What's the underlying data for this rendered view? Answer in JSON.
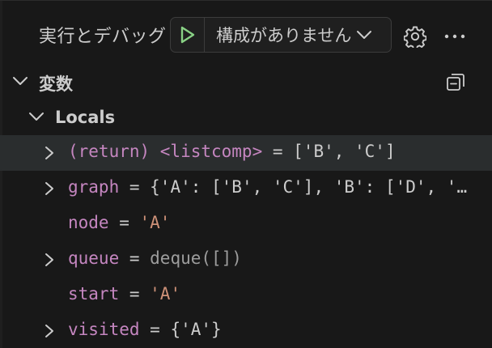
{
  "colors": {
    "background": "#181818",
    "play_green": "#89d185",
    "var_name": "#c586c0",
    "string_value": "#ce9178",
    "selected_row": "#2a2d2e"
  },
  "header": {
    "title": "実行とデバッグ",
    "start_button_icon": "play-icon",
    "config_label": "構成がありません",
    "config_dropdown_icon": "chevron-down-icon",
    "settings_icon": "gear-icon",
    "more_icon": "ellipsis-icon"
  },
  "variables": {
    "section_title": "変数",
    "collapse_icon": "collapse-all-icon",
    "scope": {
      "label": "Locals",
      "rows": [
        {
          "name": "(return) <listcomp>",
          "eq": " = ",
          "value": "['B', 'C']",
          "expandable": true,
          "selected": true
        },
        {
          "name": "graph",
          "eq": " = ",
          "value": "{'A': ['B', 'C'], 'B': ['D', '…",
          "expandable": true,
          "selected": false
        },
        {
          "name": "node",
          "eq": " = ",
          "value": "'A'",
          "expandable": false,
          "selected": false
        },
        {
          "name": "queue",
          "eq": " = ",
          "value": "deque([])",
          "expandable": true,
          "selected": false
        },
        {
          "name": "start",
          "eq": " = ",
          "value": "'A'",
          "expandable": false,
          "selected": false
        },
        {
          "name": "visited",
          "eq": " = ",
          "value": "{'A'}",
          "expandable": true,
          "selected": false
        }
      ]
    }
  }
}
